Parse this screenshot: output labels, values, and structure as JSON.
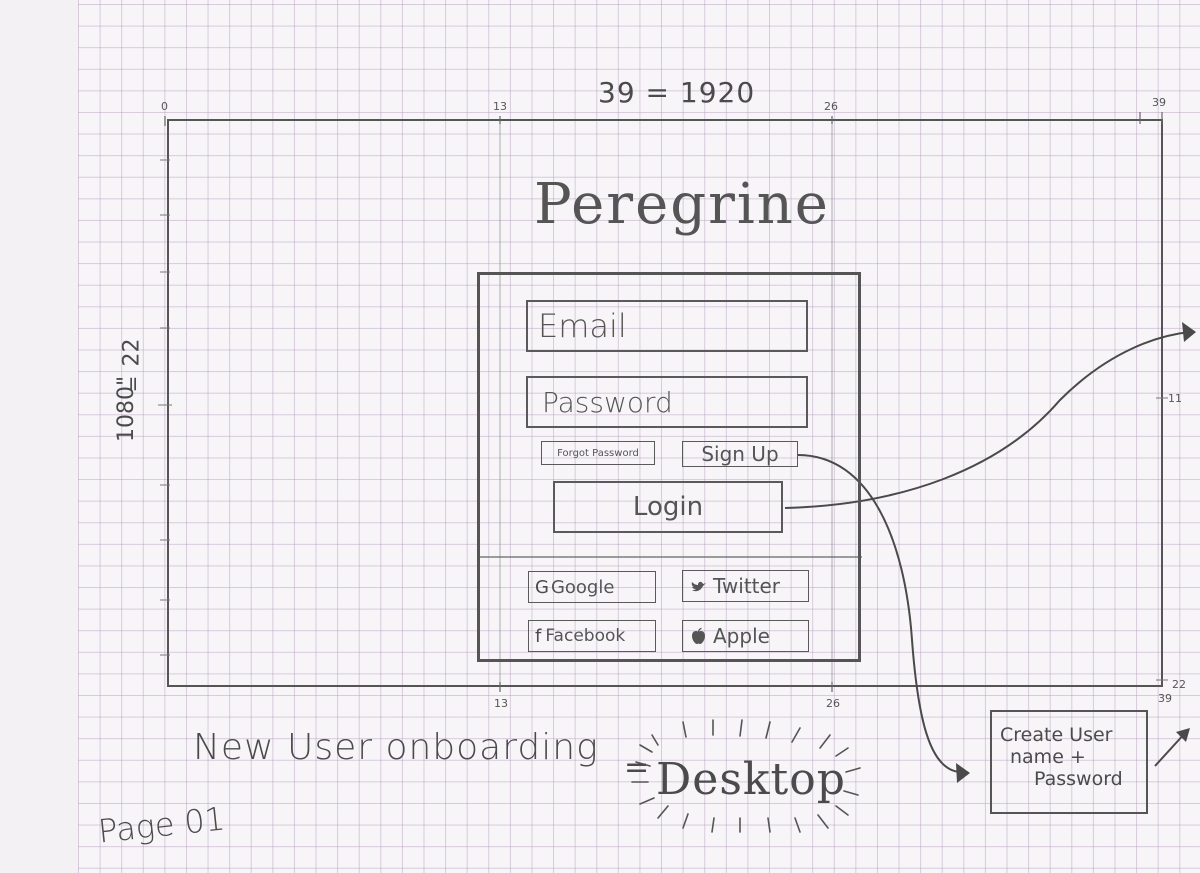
{
  "sheet": {
    "top_annotation": "39 = 1920",
    "left_annotation_top": "22",
    "left_annotation_eq": "=",
    "left_annotation_bottom": "1080\"",
    "top_ticks": [
      "0",
      "13",
      "26",
      "39"
    ],
    "bottom_ticks": [
      "13",
      "26",
      "39"
    ],
    "right_ticks": [
      "11",
      "22"
    ]
  },
  "login_mockup": {
    "app_title": "Peregrine",
    "email_placeholder": "Email",
    "password_placeholder": "Password",
    "forgot_password_label": "Forgot Password",
    "sign_up_label": "Sign Up",
    "login_label": "Login",
    "social": {
      "google_icon": "G",
      "google_label": "Google",
      "twitter_icon": "bird-icon",
      "twitter_label": "Twitter",
      "facebook_icon": "f",
      "facebook_label": "Facebook",
      "apple_icon": "apple-icon",
      "apple_label": "Apple"
    }
  },
  "footer": {
    "flow_title": "New User onboarding",
    "separator": "=",
    "platform": "Desktop",
    "page_label": "Page 01"
  },
  "annotations": {
    "create_user_line1": "Create User",
    "create_user_line2": "name +",
    "create_user_line3": "Password"
  },
  "colors": {
    "ink": "#4b4b4b",
    "grid": "#b296b9",
    "paper": "#f7f5f8"
  }
}
